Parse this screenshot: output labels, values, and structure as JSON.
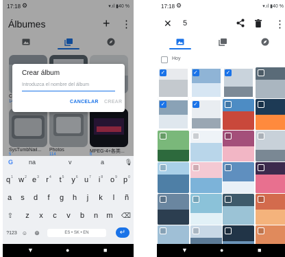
{
  "left": {
    "status": {
      "time": "17:18",
      "battery": "40 %"
    },
    "header": {
      "title": "Álbumes",
      "add_icon": "+",
      "more_icon": "⋮"
    },
    "albums": [
      {
        "label": "C",
        "count": "14"
      },
      {
        "label": "",
        "count": ""
      },
      {
        "label": "",
        "count": ""
      },
      {
        "label": "SysTumbNail...",
        "count": "5"
      },
      {
        "label": "Photos",
        "count": "114"
      },
      {
        "label": "MPEG-4+各类...",
        "count": "6"
      }
    ],
    "dialog": {
      "title": "Crear álbum",
      "placeholder": "Introduzca el nombre del álbum",
      "cancel": "CANCELAR",
      "create": "CREAR"
    },
    "keyboard": {
      "suggestions": [
        "na",
        "v",
        "a"
      ],
      "row1": [
        {
          "k": "q",
          "n": "1"
        },
        {
          "k": "w",
          "n": "2"
        },
        {
          "k": "e",
          "n": "3"
        },
        {
          "k": "r",
          "n": "4"
        },
        {
          "k": "t",
          "n": "5"
        },
        {
          "k": "y",
          "n": "6"
        },
        {
          "k": "u",
          "n": "7"
        },
        {
          "k": "i",
          "n": "8"
        },
        {
          "k": "o",
          "n": "9"
        },
        {
          "k": "p",
          "n": "0"
        }
      ],
      "row2": [
        "a",
        "s",
        "d",
        "f",
        "g",
        "h",
        "j",
        "k",
        "l",
        "ñ"
      ],
      "row3": [
        "z",
        "x",
        "c",
        "v",
        "b",
        "n",
        "m"
      ],
      "numbers_key": "?123",
      "space_label": "ES • SK • EN"
    }
  },
  "right": {
    "status": {
      "time": "17:18",
      "battery": "40 %"
    },
    "header": {
      "count": "5"
    },
    "section_label": "Hoy",
    "grid": [
      {
        "sel": true
      },
      {
        "sel": true
      },
      {
        "sel": true
      },
      {
        "sel": false
      },
      {
        "sel": true
      },
      {
        "sel": true
      },
      {
        "sel": false
      },
      {
        "sel": false
      },
      {
        "sel": false
      },
      {
        "sel": false
      },
      {
        "sel": false
      },
      {
        "sel": false
      },
      {
        "sel": false
      },
      {
        "sel": false
      },
      {
        "sel": false
      },
      {
        "sel": false
      },
      {
        "sel": false
      },
      {
        "sel": false
      },
      {
        "sel": false
      },
      {
        "sel": false
      },
      {
        "sel": false
      },
      {
        "sel": false
      },
      {
        "sel": false
      },
      {
        "sel": false
      }
    ]
  }
}
